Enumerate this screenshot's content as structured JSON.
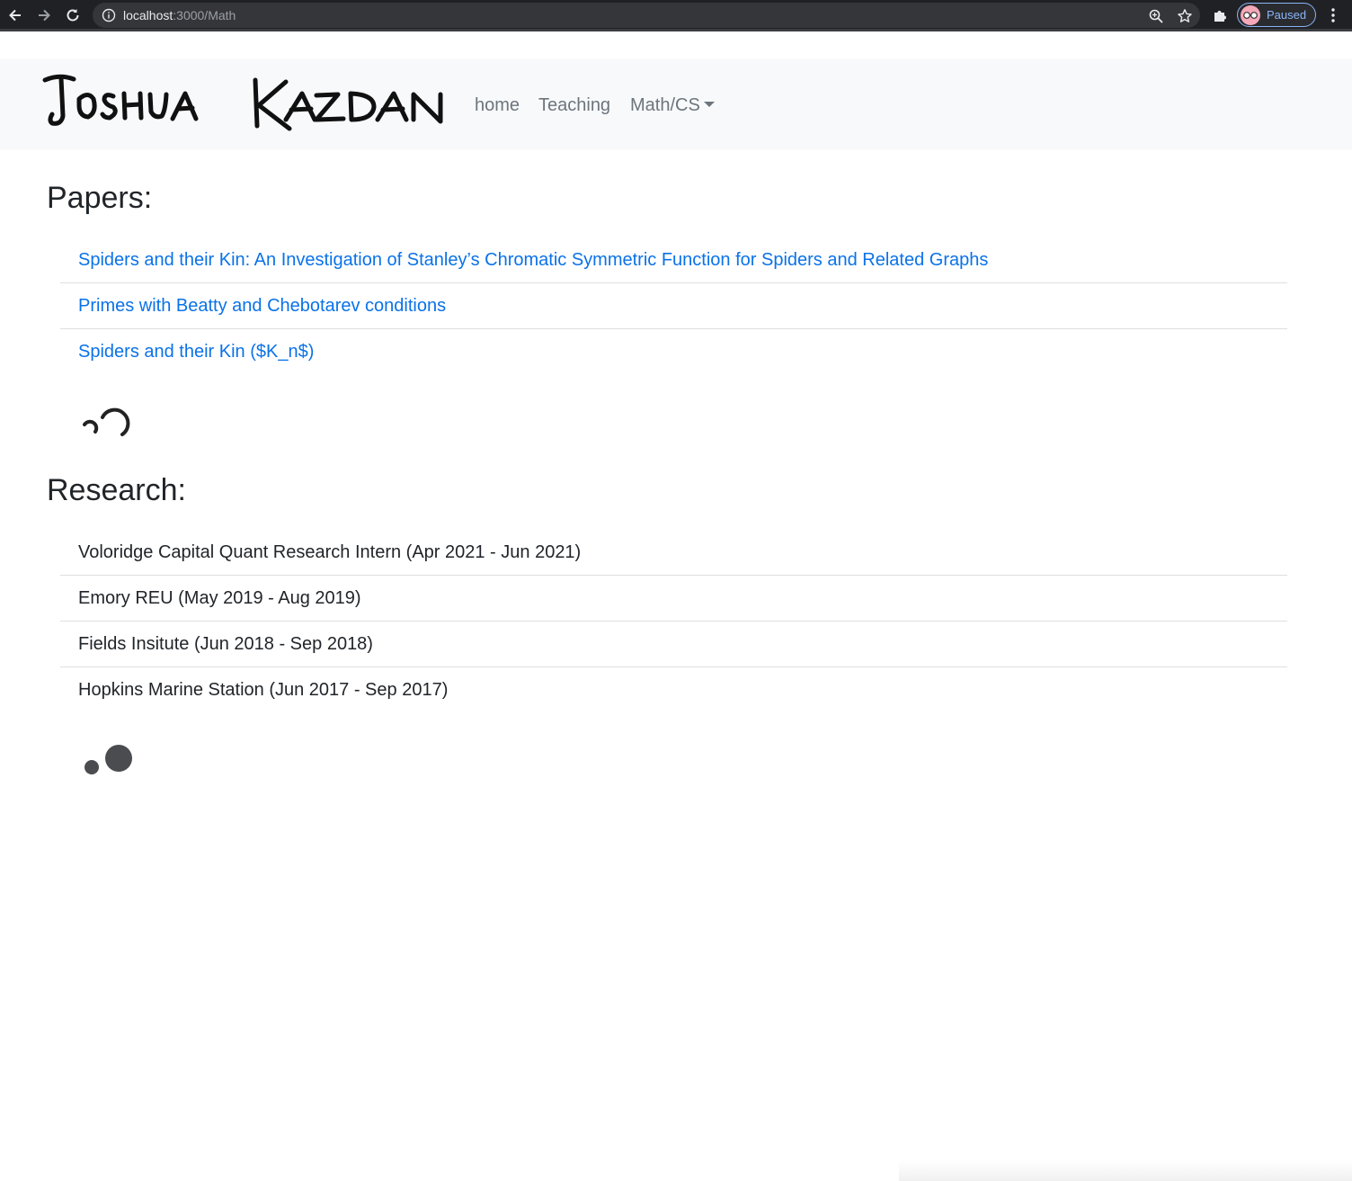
{
  "browser": {
    "url_host": "localhost",
    "url_path": ":3000/Math",
    "profile_label": "Paused",
    "icons": [
      "back-icon",
      "forward-icon",
      "reload-icon",
      "info-icon",
      "zoom-icon",
      "star-icon",
      "extensions-icon",
      "menu-icon"
    ]
  },
  "navbar": {
    "brand": "Joshua Kazdan",
    "links": [
      "home",
      "Teaching",
      "Math/CS"
    ]
  },
  "papers": {
    "heading": "Papers:",
    "items": [
      "Spiders and their Kin: An Investigation of Stanley’s Chromatic Symmetric Function for Spiders and Related Graphs",
      "Primes with Beatty and Chebotarev conditions",
      "Spiders and their Kin ($K_n$)"
    ]
  },
  "research": {
    "heading": "Research:",
    "items": [
      "Voloridge Capital Quant Research Intern (Apr 2021 - Jun 2021)",
      "Emory REU (May 2019 - Aug 2019)",
      "Fields Insitute (Jun 2018 - Sep 2018)",
      "Hopkins Marine Station (Jun 2017 - Sep 2017)"
    ]
  },
  "colors": {
    "link": "#0a72e8",
    "navbar_bg": "#f8f9fa",
    "nav_text": "#6c757d",
    "chrome_bg": "#202124"
  }
}
